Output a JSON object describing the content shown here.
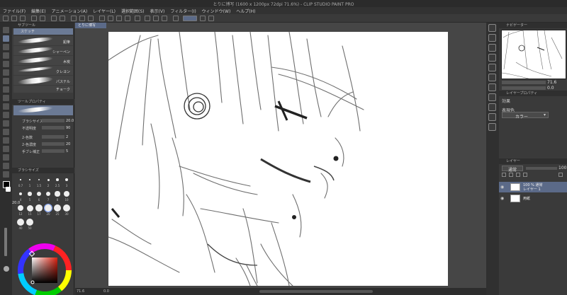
{
  "app": {
    "title": "とりに博写 (1600 x 1200px 72dpi 71.6%) - CLIP STUDIO PAINT PRO"
  },
  "menu": [
    "ファイル(F)",
    "編集(E)",
    "アニメーション(A)",
    "レイヤー(L)",
    "選択範囲(S)",
    "表示(V)",
    "フィルター(I)",
    "ウィンドウ(W)",
    "ヘルプ(H)"
  ],
  "document_tab": "とりに博写",
  "left_panel": {
    "subtool_group_title": "サブツール",
    "subtool_header": "スケッチ",
    "subtools": [
      {
        "label": "鉛筆"
      },
      {
        "label": "シャーペン"
      },
      {
        "label": "木炭"
      },
      {
        "label": "クレヨン"
      },
      {
        "label": "パステル"
      },
      {
        "label": "チョーク"
      }
    ],
    "tool_property_title": "ツールプロパティ",
    "properties": [
      {
        "key": "ブラシサイズ",
        "value": "20.0"
      },
      {
        "key": "不透明度",
        "value": "90"
      },
      {
        "key": "2-色数",
        "value": "2"
      },
      {
        "key": "2-色濃度",
        "value": "20"
      },
      {
        "key": "手ブレ補正",
        "value": "5"
      }
    ],
    "brush_size_title": "ブラシサイズ",
    "brush_sizes": [
      "0.7",
      "1",
      "1.5",
      "2",
      "2.5",
      "3",
      "4",
      "5",
      "6",
      "7",
      "8",
      "10",
      "12",
      "15",
      "17",
      "20",
      "25",
      "30",
      "40",
      "50"
    ],
    "current_size": "20.0"
  },
  "right_panel": {
    "navigator_title": "ナビゲーター",
    "zoom": "71.6",
    "rotate": "0.0",
    "layer_property_title": "レイヤープロパティ",
    "effect_label": "効果",
    "color_mode_label": "表現色",
    "color_mode_value": "カラー",
    "layers_title": "レイヤー",
    "blend_mode": "通常",
    "opacity": "100",
    "layers": [
      {
        "name_line1": "100 % 通常",
        "name_line2": "レイヤー 1",
        "selected": true
      },
      {
        "name_line1": "",
        "name_line2": "用紙",
        "selected": false
      }
    ]
  },
  "status": {
    "zoom": "71.6",
    "coords": "0.0"
  },
  "colors": {
    "accent": "#5b6a88",
    "panel": "#3a3a3a",
    "canvas_bg": "#464646"
  }
}
